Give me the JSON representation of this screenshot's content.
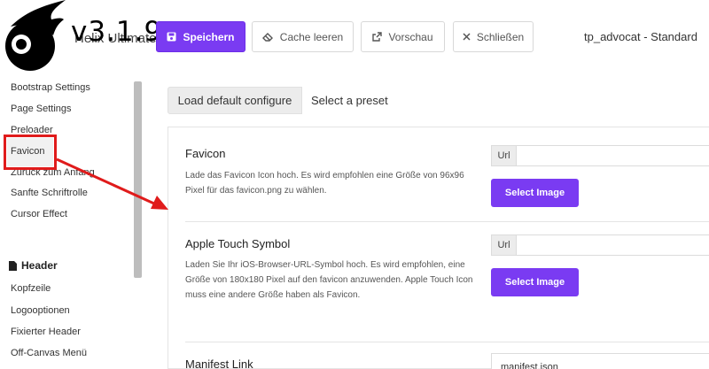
{
  "header": {
    "brand_under": "Helix Ultimate",
    "version": "v3.1.9",
    "template_name": "tp_advocat - Standard"
  },
  "toolbar": {
    "save_label": "Speichern",
    "cache_label": "Cache leeren",
    "preview_label": "Vorschau",
    "close_label": "Schließen"
  },
  "sidebar": {
    "items_top": [
      {
        "label": "Bootstrap Settings"
      },
      {
        "label": "Page Settings"
      },
      {
        "label": "Preloader"
      },
      {
        "label": "Favicon"
      },
      {
        "label": "Zurück zum Anfang"
      },
      {
        "label": "Sanfte Schriftrolle"
      },
      {
        "label": "Cursor Effect"
      }
    ],
    "section_header": "Header",
    "items_header": [
      {
        "label": "Kopfzeile"
      },
      {
        "label": "Logooptionen"
      },
      {
        "label": "Fixierter Header"
      },
      {
        "label": "Off-Canvas Menü"
      }
    ]
  },
  "presets": {
    "default_label": "Load default configure",
    "select_label": "Select a preset"
  },
  "fields": {
    "favicon": {
      "title": "Favicon",
      "description": "Lade das Favicon Icon hoch. Es wird empfohlen eine Größe von 96x96 Pixel für das favicon.png zu wählen.",
      "url_addon": "Url",
      "button": "Select Image"
    },
    "apple": {
      "title": "Apple Touch Symbol",
      "description": "Laden Sie Ihr iOS-Browser-URL-Symbol hoch. Es wird empfohlen, eine Größe von 180x180 Pixel auf den favicon anzuwenden. Apple Touch Icon muss eine andere Größe haben als Favicon.",
      "url_addon": "Url",
      "button": "Select Image"
    },
    "manifest": {
      "title": "Manifest Link",
      "value": "manifest.json"
    }
  },
  "colors": {
    "accent": "#7a3bf2",
    "annotation": "#e01b1b"
  }
}
